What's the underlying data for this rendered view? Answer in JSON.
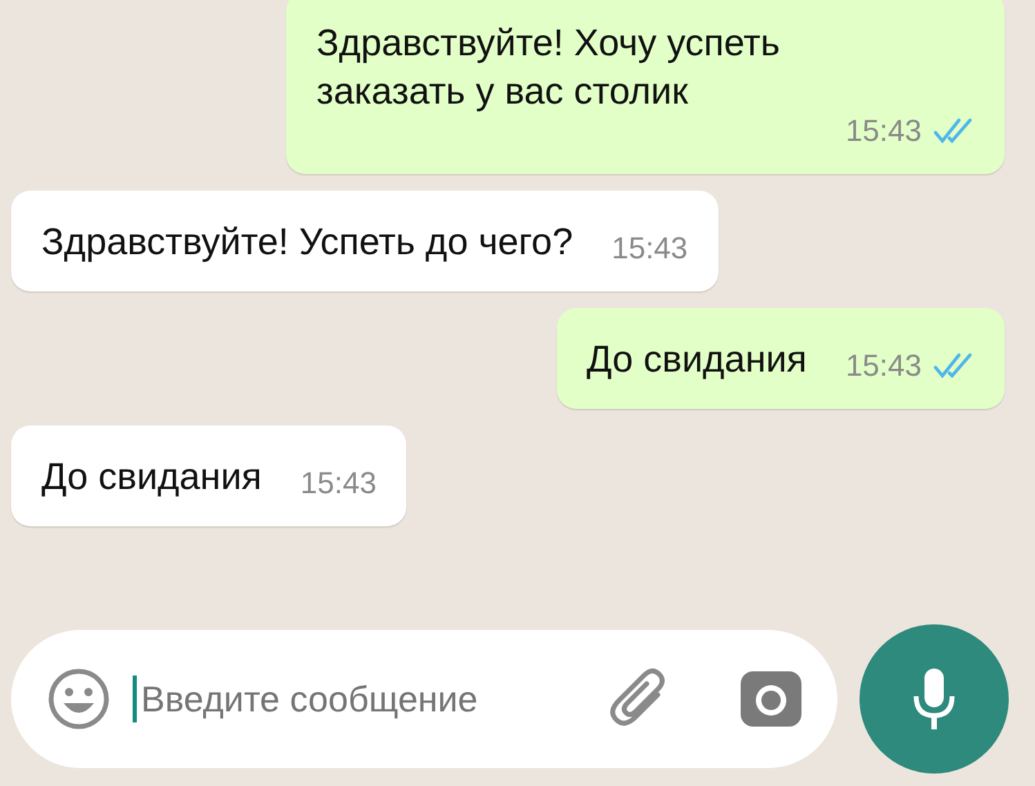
{
  "messages": [
    {
      "kind": "out",
      "text": "Здравствуйте! Хочу успеть заказать у вас столик",
      "time": "15:43",
      "read": true
    },
    {
      "kind": "in",
      "text": "Здравствуйте! Успеть до чего?",
      "time": "15:43"
    },
    {
      "kind": "out",
      "text": "До свидания",
      "time": "15:43",
      "read": true
    },
    {
      "kind": "in",
      "text": "До свидания",
      "time": "15:43"
    }
  ],
  "composer": {
    "placeholder": "Введите сообщение"
  }
}
